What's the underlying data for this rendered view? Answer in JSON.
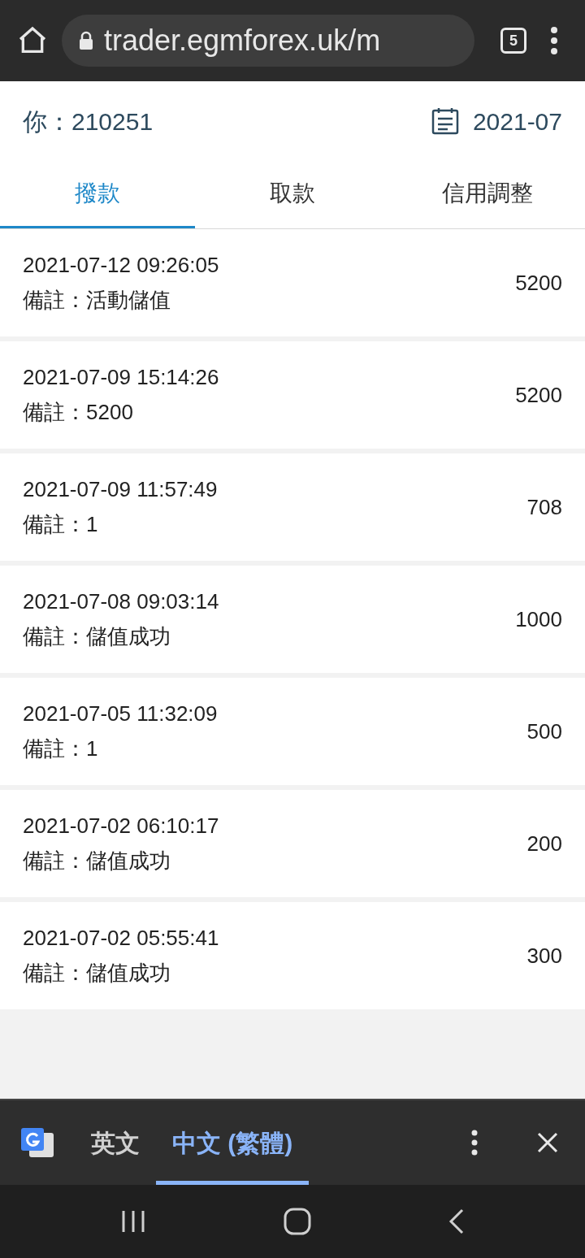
{
  "browser": {
    "url": "trader.egmforex.uk/m",
    "tab_count": "5"
  },
  "header": {
    "account": "你：210251",
    "month": "2021-07"
  },
  "tabs": [
    {
      "label": "撥款",
      "selected": true
    },
    {
      "label": "取款",
      "selected": false
    },
    {
      "label": "信用調整",
      "selected": false
    }
  ],
  "records": [
    {
      "time": "2021-07-12 09:26:05",
      "note": "備註：活動儲值",
      "amount": "5200"
    },
    {
      "time": "2021-07-09 15:14:26",
      "note": "備註：5200",
      "amount": "5200"
    },
    {
      "time": "2021-07-09 11:57:49",
      "note": "備註：1",
      "amount": "708"
    },
    {
      "time": "2021-07-08 09:03:14",
      "note": "備註：儲值成功",
      "amount": "1000"
    },
    {
      "time": "2021-07-05 11:32:09",
      "note": "備註：1",
      "amount": "500"
    },
    {
      "time": "2021-07-02 06:10:17",
      "note": "備註：儲值成功",
      "amount": "200"
    },
    {
      "time": "2021-07-02 05:55:41",
      "note": "備註：儲值成功",
      "amount": "300"
    }
  ],
  "translate_bar": {
    "languages": [
      {
        "label": "英文",
        "selected": false
      },
      {
        "label": "中文 (繁體)",
        "selected": true
      }
    ]
  }
}
